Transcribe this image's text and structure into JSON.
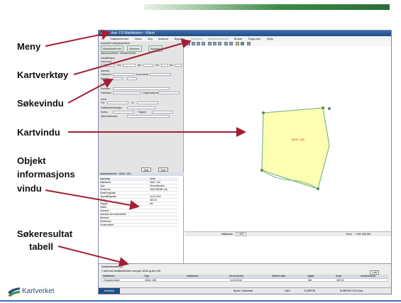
{
  "slide": {
    "labels": {
      "meny": "Meny",
      "kartverktoy": "Kartverktøy",
      "sokevindu": "Søkevindu",
      "kartvindu": "Kartvindu",
      "objekt_line1": "Objekt",
      "objekt_line2": "informasjons",
      "objekt_line3": "vindu",
      "sokeresultat_line1": "Søkeresultat",
      "sokeresultat_line2": "tabell"
    },
    "logo_text": "Kartverket",
    "colors": {
      "arrow": "#a41e35",
      "parcel_fill": "#ffffb3",
      "parcel_stroke": "#7ab88a",
      "brand_blue": "#2a4d7e"
    }
  },
  "app": {
    "title": "Kartverket: FS Matrikkelen - Klient",
    "menu": [
      "Fil",
      "Matrikkelenhet",
      "Vindu",
      "Veg",
      "Adresse",
      "Bygning",
      "Kodeliste",
      "Matrikkelkontroll",
      "Bruker",
      "Rapporter",
      "Hjelp"
    ],
    "search_panel": {
      "header": "Avanserte søkeparametere",
      "tabs": [
        "Matrikkelenhet",
        "Adresse",
        "Bygning"
      ],
      "lines": [
        "Søkeparametere: Matrikkelenhet",
        "Identifikasjon",
        "Kommune",
        "Gnr",
        "Bnr",
        "Fnr",
        "Snr",
        "Adresse",
        "Gatenavn",
        "Husnummer",
        "Bokstav",
        "Eier",
        "Eiernavn",
        "Fødselsnr",
        "Organisasjonsnr",
        "Areal",
        "Fra",
        "Til",
        "Matrikkelenhetstype",
        "Status",
        "Tinglyst",
        "Hjemmelshaver"
      ],
      "search_button": "Søk",
      "clear_button": "Tøm"
    },
    "info_panel": {
      "header": "Matrikkelenhet : 1818 / 150",
      "rows": [
        {
          "key": "Egenskap",
          "value": "Verdi"
        },
        {
          "key": "Matrikkelnr",
          "value": "1818 / 150"
        },
        {
          "key": "Type",
          "value": "Grunneiendom"
        },
        {
          "key": "Kommune",
          "value": "1818 HERØY (N)"
        },
        {
          "key": "Etableringsdato",
          "value": ""
        },
        {
          "key": "Oppmålingsdato",
          "value": "14.03.2012"
        },
        {
          "key": "Areal",
          "value": "3672.5"
        },
        {
          "key": "Tinglyst",
          "value": "Nei"
        },
        {
          "key": "Status",
          "value": ""
        },
        {
          "key": "Adresser",
          "value": ""
        },
        {
          "key": "Adresser fra bruksenheter",
          "value": ""
        },
        {
          "key": "Hjemmel",
          "value": ""
        },
        {
          "key": "Eierforhold",
          "value": ""
        },
        {
          "key": "Kommentarer",
          "value": ""
        }
      ]
    },
    "map": {
      "parcel_label": "1818 / 150",
      "scale_label": "Målestokk",
      "scale_value": "1:500",
      "coord_label": "Nord",
      "coord_value": "7 401 045,262"
    },
    "result_panel": {
      "title": "Matrikkelenheter (1)",
      "subtitle": "1 treff med matrikkelenheter med gnr=1818 og  bnr=150",
      "columns": [
        "Matrikkelnr",
        "Type",
        "Matrikkelnr",
        "Sist forandret",
        "Etablert dato",
        "Utgått",
        "Areal",
        "Arealmerknad"
      ],
      "rows": [
        [
          "Grunneiendom",
          "1818 / 150",
          "",
          "14.03.2012",
          "",
          "Nei",
          "3672.5",
          ""
        ]
      ],
      "button_label": "Lukk"
    },
    "statusbar": {
      "tab_label": "Matrikkel",
      "user": "Bruker: Kartverket",
      "kommune": "1818",
      "srs": "EUREF89",
      "datum": "EUREF89 UTM Sone"
    }
  }
}
